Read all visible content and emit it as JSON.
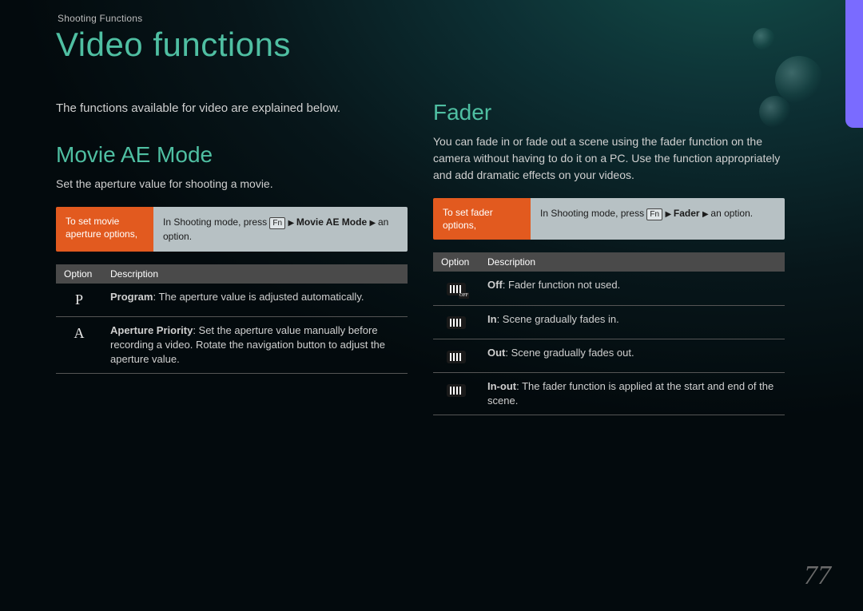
{
  "breadcrumb": "Shooting Functions",
  "page_title": "Video functions",
  "page_number": "77",
  "left": {
    "intro": "The functions available for video are explained below.",
    "heading": "Movie AE Mode",
    "sub": "Set the aperture value for shooting a movie.",
    "instr_label": "To set movie aperture options,",
    "instr_prefix": "In Shooting mode, press ",
    "instr_fn": "Fn",
    "instr_path": "Movie AE Mode",
    "instr_suffix": "an option.",
    "table": {
      "th_option": "Option",
      "th_desc": "Description",
      "rows": [
        {
          "opt": "P",
          "label": "Program",
          "text": ": The aperture value is adjusted automatically."
        },
        {
          "opt": "A",
          "label": "Aperture Priority",
          "text": ": Set the aperture value manually before recording a video. Rotate the navigation button to adjust the aperture value."
        }
      ]
    }
  },
  "right": {
    "heading": "Fader",
    "sub": "You can fade in or fade out a scene using the fader function on the camera without having to do it on a PC. Use the function appropriately and add dramatic effects on your videos.",
    "instr_label": "To set fader options,",
    "instr_prefix": "In Shooting mode, press ",
    "instr_fn": "Fn",
    "instr_path": "Fader",
    "instr_suffix": "an option.",
    "table": {
      "th_option": "Option",
      "th_desc": "Description",
      "rows": [
        {
          "icon": "off",
          "label": "Off",
          "text": ": Fader function not used."
        },
        {
          "icon": "plain",
          "label": "In",
          "text": ": Scene gradually fades in."
        },
        {
          "icon": "plain",
          "label": "Out",
          "text": ": Scene gradually fades out."
        },
        {
          "icon": "plain",
          "label": "In-out",
          "text": ": The fader function is applied at the start and end of the scene."
        }
      ]
    }
  }
}
